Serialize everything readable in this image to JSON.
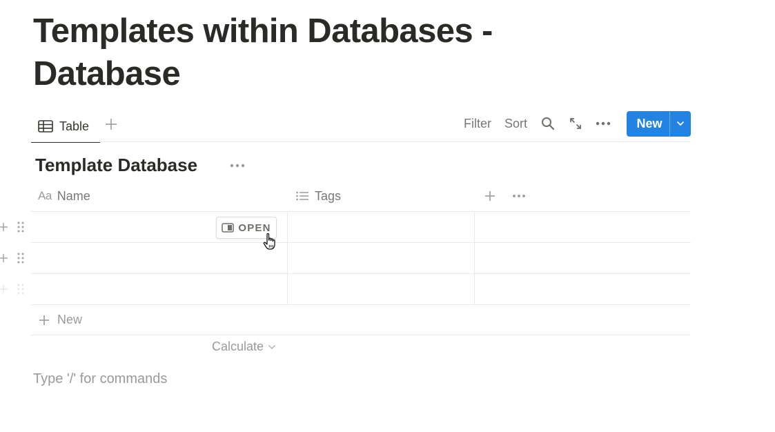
{
  "page": {
    "title": "Templates within Databases - Database",
    "command_placeholder": "Type '/' for commands"
  },
  "view_bar": {
    "active_tab_label": "Table",
    "filter_label": "Filter",
    "sort_label": "Sort",
    "new_button_label": "New",
    "icons": [
      "table-icon",
      "plus-icon",
      "search-icon",
      "expand-icon",
      "more-icon",
      "chevron-down-icon"
    ]
  },
  "database": {
    "title": "Template Database",
    "columns": [
      {
        "label": "Name",
        "icon": "Aa"
      },
      {
        "label": "Tags",
        "icon": "list-icon"
      }
    ],
    "rows": [
      {
        "name": "",
        "tags": ""
      },
      {
        "name": "",
        "tags": ""
      },
      {
        "name": "",
        "tags": ""
      }
    ],
    "open_button_label": "OPEN",
    "new_row_label": "New",
    "calculate_label": "Calculate"
  },
  "colors": {
    "accent": "#2383e2",
    "text": "#37352f",
    "muted": "#787774",
    "placeholder": "#9b9a97",
    "border": "#e9e9e7"
  }
}
